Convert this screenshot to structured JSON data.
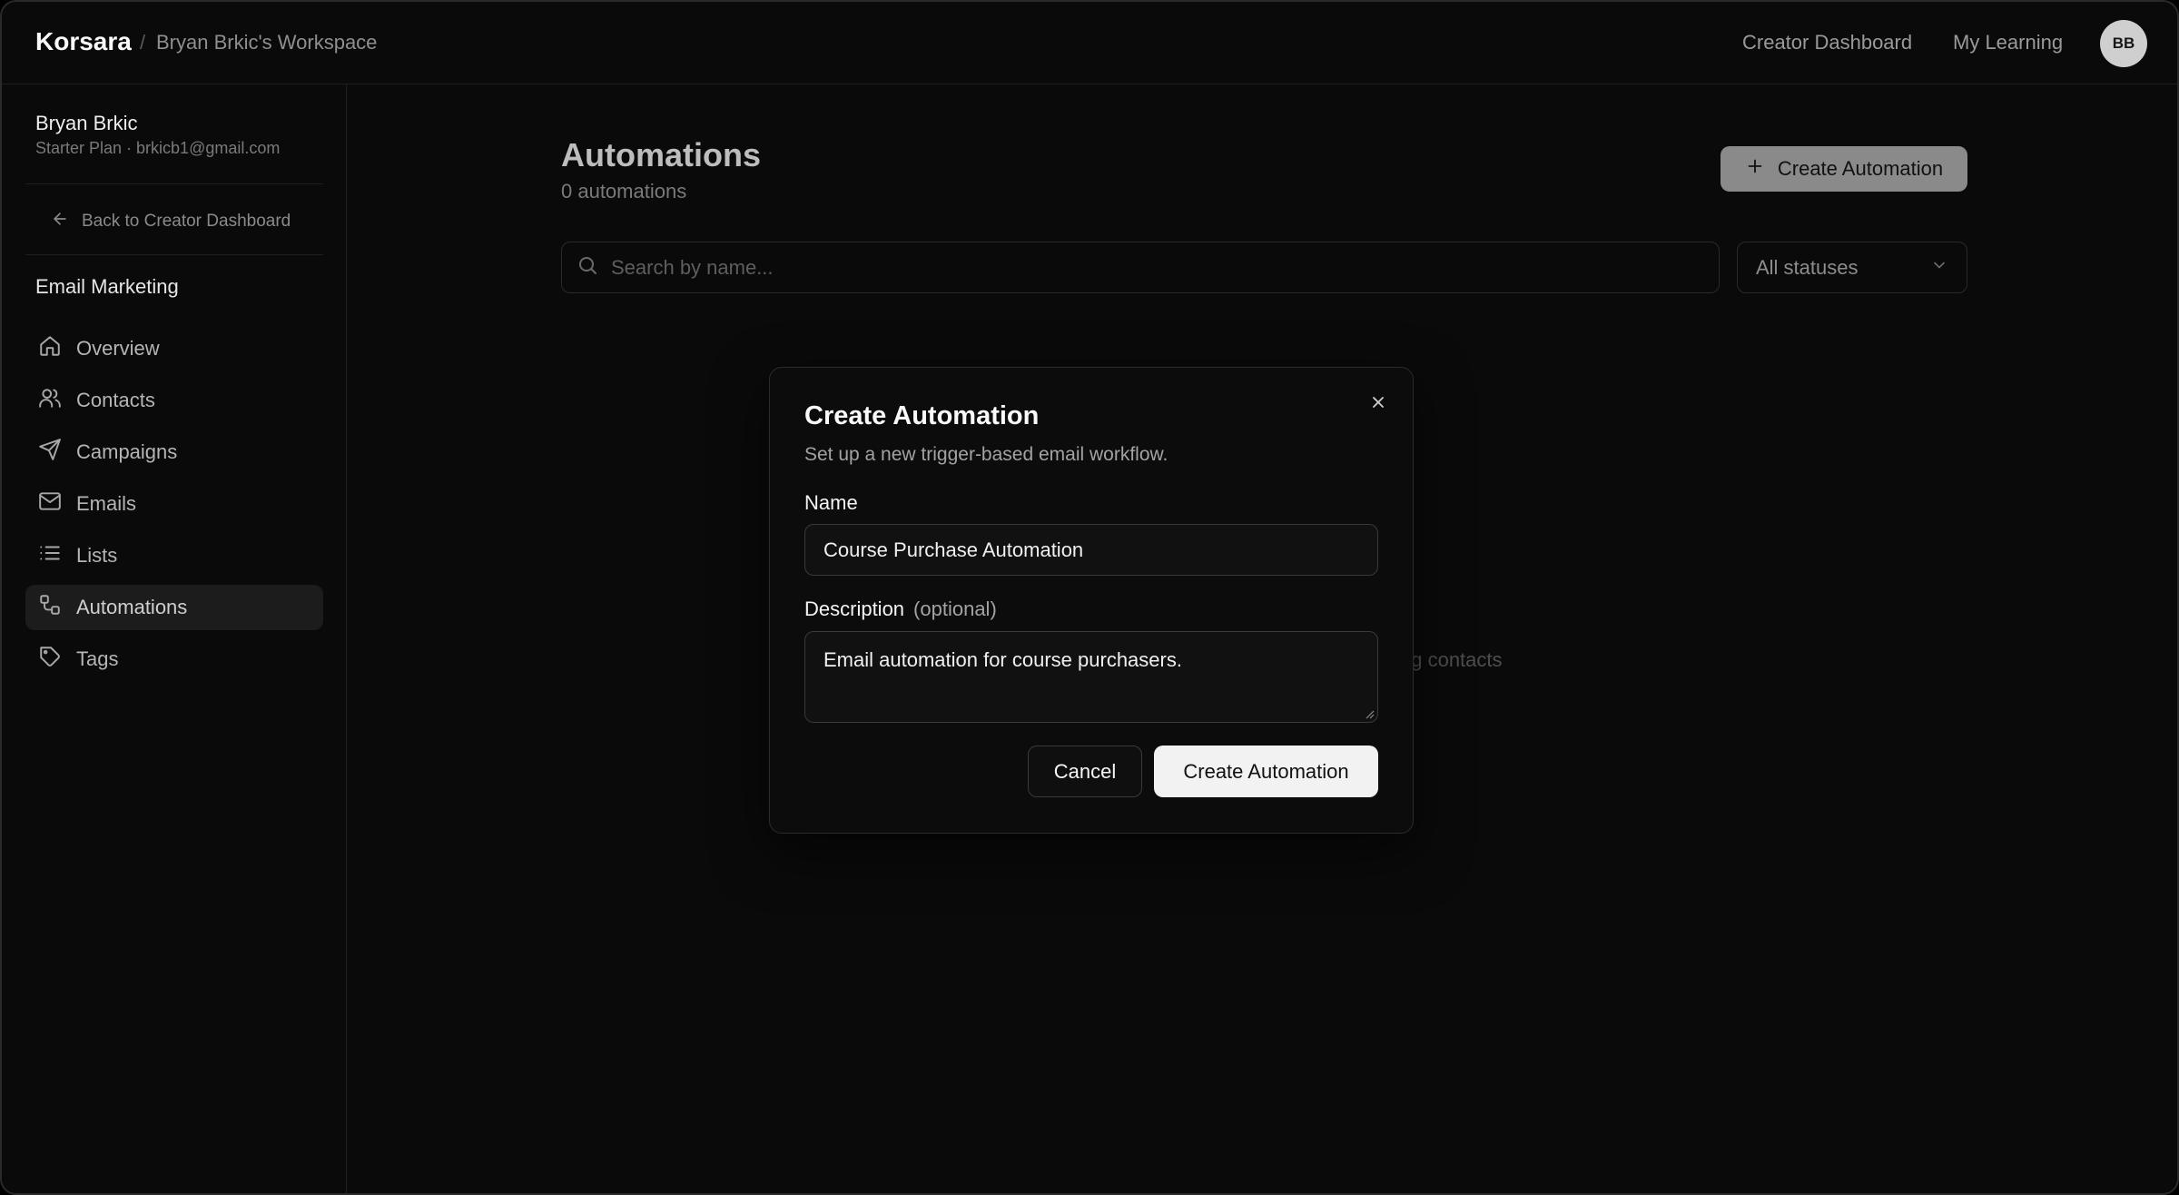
{
  "header": {
    "brand": "Korsara",
    "separator": "/",
    "workspace": "Bryan Brkic's Workspace",
    "nav": {
      "creator_dashboard": "Creator Dashboard",
      "my_learning": "My Learning"
    },
    "avatar_initials": "BB"
  },
  "sidebar": {
    "user_name": "Bryan Brkic",
    "user_meta": "Starter Plan · brkicb1@gmail.com",
    "back_label": "Back to Creator Dashboard",
    "section_title": "Email Marketing",
    "items": [
      {
        "label": "Overview",
        "icon": "home-icon"
      },
      {
        "label": "Contacts",
        "icon": "users-icon"
      },
      {
        "label": "Campaigns",
        "icon": "send-icon"
      },
      {
        "label": "Emails",
        "icon": "mail-icon"
      },
      {
        "label": "Lists",
        "icon": "list-icon"
      },
      {
        "label": "Automations",
        "icon": "workflow-icon",
        "active": true
      },
      {
        "label": "Tags",
        "icon": "tag-icon"
      }
    ]
  },
  "main": {
    "title": "Automations",
    "count": "0 automations",
    "create_button": "Create Automation",
    "search_placeholder": "Search by name...",
    "status_filter": "All statuses",
    "empty_fragment": "ng contacts"
  },
  "modal": {
    "title": "Create Automation",
    "subtitle": "Set up a new trigger-based email workflow.",
    "name_label": "Name",
    "name_value": "Course Purchase Automation",
    "description_label": "Description",
    "description_optional": "(optional)",
    "description_value": "Email automation for course purchasers.",
    "cancel_label": "Cancel",
    "submit_label": "Create Automation"
  }
}
